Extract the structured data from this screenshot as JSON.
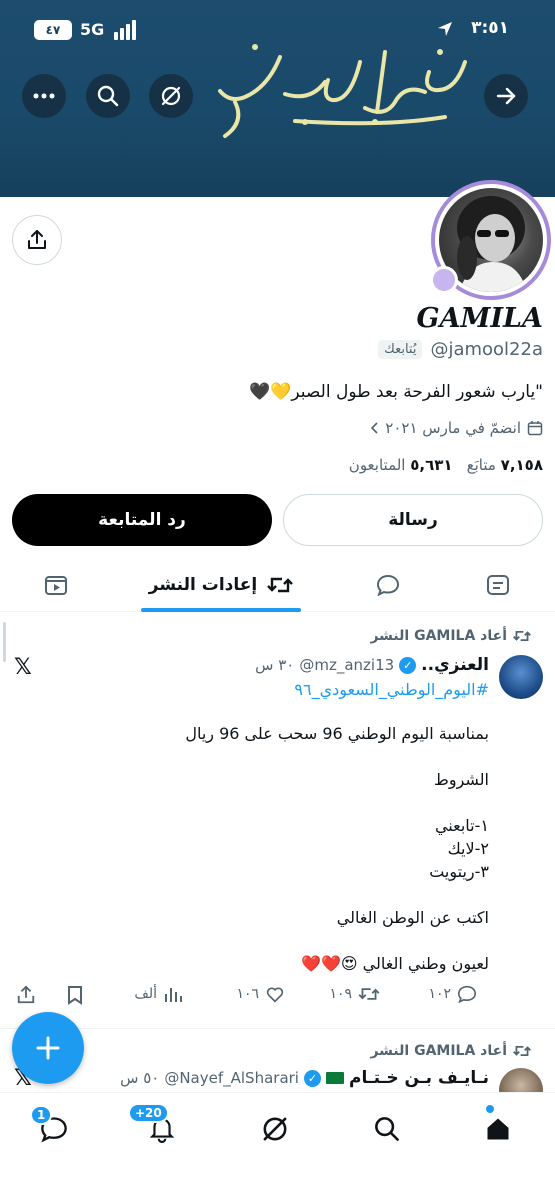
{
  "status_bar": {
    "time": "٣:٥١",
    "network": "5G",
    "battery": "٤٧"
  },
  "header": {
    "banner_text": "رب اشرح لي صدري"
  },
  "profile": {
    "display_name": "GAMILA",
    "handle": "@jamool22a",
    "follows_you": "يُتابعك",
    "bio": "\"يارب شعور الفرحة بعد طول الصبر💛🖤",
    "joined": "انضمّ في مارس ٢٠٢١",
    "following_count": "٧,١٥٨",
    "following_label": "متابَع",
    "followers_count": "٥,٦٣١",
    "followers_label": "المتابعون"
  },
  "buttons": {
    "message": "رسالة",
    "follow_back": "رد المتابعة"
  },
  "tabs": {
    "reposts": "إعادات النشر"
  },
  "posts": [
    {
      "repost_label": "أعاد GAMILA النشر",
      "author": "العنزي..",
      "handle": "@mz_anzi13",
      "time": "٣٠ س",
      "hashtag": "#اليوم_الوطني_السعودي_٩٦",
      "lines": [
        "بمناسبة اليوم الوطني 96 سحب على 96 ريال",
        "",
        "الشروط",
        "",
        "١-تابعني",
        "٢-لايك",
        "٣-ريتويت",
        "",
        "اكتب عن الوطن الغالي",
        "",
        "لعيون وطني الغالي 😍❤️❤️"
      ],
      "replies": "١٠٢",
      "reposts": "١٠٩",
      "likes": "١٠٦",
      "views": "ألف"
    },
    {
      "repost_label": "أعاد GAMILA النشر",
      "author": "نـايـف بـن خـتـام",
      "handle": "@Nayef_AlSharari",
      "time": "٥٠ س"
    }
  ],
  "bottom_nav": {
    "notifications_badge": "+20",
    "messages_badge": "1"
  },
  "colors": {
    "accent": "#1d9bf0",
    "banner": "#1a4a6a",
    "avatar_ring": "#a78bdb"
  }
}
